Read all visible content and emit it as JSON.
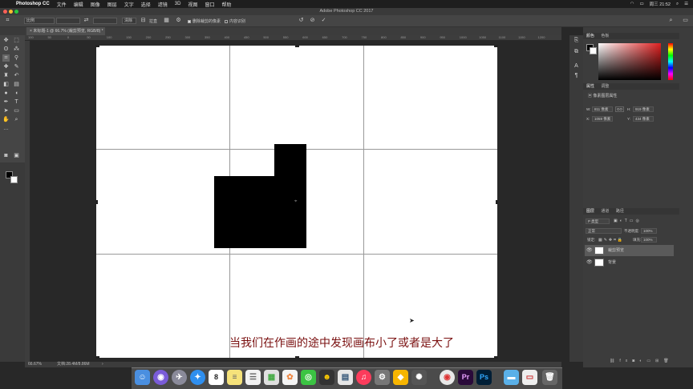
{
  "menubar": {
    "app_name": "Photoshop CC",
    "items": [
      "文件",
      "编辑",
      "图像",
      "图层",
      "文字",
      "选择",
      "滤镜",
      "3D",
      "视图",
      "窗口",
      "帮助"
    ],
    "clock": "周三 21:52"
  },
  "window": {
    "title": "Adobe Photoshop CC 2017"
  },
  "options": {
    "ratio": "比例",
    "clear": "清除",
    "straighten": "拉直",
    "delete_cropped": "删除裁剪的像素",
    "content_aware": "内容识别"
  },
  "document": {
    "tab_title": "未标题-1 @ 66.7% (裁剪预览, RGB/8) *",
    "zoom": "66.67%",
    "file_info": "文档:28.4M/8.86M",
    "ruler_labels": [
      "100",
      "50",
      "0",
      "50",
      "100",
      "150",
      "200",
      "250",
      "300",
      "350",
      "400",
      "450",
      "500",
      "550",
      "600",
      "650",
      "700",
      "750",
      "800",
      "850",
      "900",
      "950",
      "1000",
      "1050",
      "1100",
      "1150",
      "1200"
    ]
  },
  "caption": "当我们在作画的途中发现画布小了或者是大了",
  "color_panel": {
    "tabs": [
      "颜色",
      "色板"
    ]
  },
  "properties_panel": {
    "tabs": [
      "属性",
      "调整"
    ],
    "title": "像素图层属性",
    "w": "811 像素",
    "h": "919 像素",
    "x": "1059 像素",
    "y": "434 像素",
    "w_label": "W:",
    "h_label": "H:",
    "x_label": "X:",
    "y_label": "Y:",
    "link": "GO"
  },
  "layers_panel": {
    "tabs": [
      "图层",
      "通道",
      "路径"
    ],
    "filter_placeholder": "P 类型",
    "blend_mode": "正常",
    "opacity_label": "不透明度:",
    "opacity": "100%",
    "lock_label": "锁定:",
    "fill_label": "填充:",
    "fill": "100%",
    "layers": [
      {
        "name": "裁剪预览",
        "selected": true
      },
      {
        "name": "背景",
        "selected": false
      }
    ]
  },
  "dock": {
    "apps": [
      "finder",
      "siri",
      "launchpad",
      "safari",
      "calendar",
      "notes",
      "reminders",
      "photos",
      "photos2",
      "wechat",
      "qq",
      "preview",
      "music",
      "system-prefs",
      "sketch",
      "app",
      "chrome",
      "premiere",
      "photoshop",
      "folder",
      "screenshot",
      "trash"
    ],
    "calendar_day": "8",
    "premiere_label": "Pr",
    "photoshop_label": "Ps"
  }
}
